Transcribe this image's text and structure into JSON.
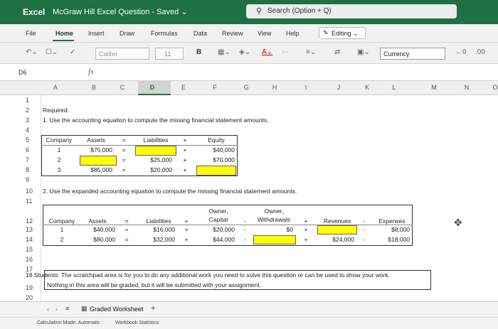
{
  "titlebar": {
    "app_name": "Excel",
    "document": "McGraw Hill Excel Question  -  Saved ⌄",
    "search_placeholder": "Search (Option + Q)"
  },
  "menu": {
    "file": "File",
    "home": "Home",
    "insert": "Insert",
    "draw": "Draw",
    "formulas": "Formulas",
    "data": "Data",
    "review": "Review",
    "view": "View",
    "help": "Help",
    "editing": "Editing ⌄"
  },
  "ribbon": {
    "font_name": "Calibri",
    "font_size": "11",
    "bold": "B",
    "number_format": "Currency"
  },
  "formula_bar": {
    "name_box": "D6",
    "fx": "fx"
  },
  "columns": [
    "A",
    "B",
    "C",
    "D",
    "E",
    "F",
    "G",
    "H",
    "I",
    "J",
    "K",
    "L",
    "M",
    "N",
    "O"
  ],
  "rows": [
    "1",
    "2",
    "3",
    "4",
    "5",
    "6",
    "7",
    "8",
    "9",
    "10",
    "11",
    "12",
    "13",
    "14",
    "15",
    "16",
    "17",
    "18",
    "19",
    "20"
  ],
  "sheet": {
    "required": "Required:",
    "instruction1": "1. Use the accounting equation to compute the missing financial statement amounts.",
    "t1_headers": {
      "company": "Company",
      "assets": "Assets",
      "eq": "=",
      "liabilities": "Liabilities",
      "plus": "+",
      "equity": "Equity"
    },
    "t1_rows": [
      {
        "company": "1",
        "assets": "$75,000",
        "eq": "=",
        "liabilities": "",
        "plus": "+",
        "equity": "$40,000"
      },
      {
        "company": "2",
        "assets": "",
        "eq": "=",
        "liabilities": "$25,000",
        "plus": "+",
        "equity": "$70,000"
      },
      {
        "company": "3",
        "assets": "$85,000",
        "eq": "=",
        "liabilities": "$20,000",
        "plus": "+",
        "equity": ""
      }
    ],
    "instruction2": "2. Use the expanded accounting equation to compute the missing financial statement amounts.",
    "t2_headers": {
      "company": "Company",
      "assets": "Assets",
      "eq": "=",
      "liabilities": "Liabilities",
      "plus1": "+",
      "owner_capital_1": "Owner,",
      "owner_capital_2": "Capital",
      "minus1": "-",
      "owner_withdrawals_1": "Owner,",
      "owner_withdrawals_2": "Withdrawals",
      "plus2": "+",
      "revenues": "Revenues",
      "minus2": "-",
      "expenses": "Expenses"
    },
    "t2_rows": [
      {
        "company": "1",
        "assets": "$40,000",
        "eq": "=",
        "liabilities": "$16,000",
        "plus1": "+",
        "capital": "$20,000",
        "minus1": "-",
        "withdrawals": "$0",
        "plus2": "+",
        "revenues": "",
        "minus2": "-",
        "expenses": "$8,000"
      },
      {
        "company": "2",
        "assets": "$80,000",
        "eq": "=",
        "liabilities": "$32,000",
        "plus1": "+",
        "capital": "$44,000",
        "minus1": "-",
        "withdrawals": "",
        "plus2": "+",
        "revenues": "$24,000",
        "minus2": "-",
        "expenses": "$18,000"
      }
    ],
    "scratch1": "18  Students: The scratchpad area is for you to do any additional work you need to solve this question or can be used to show your work.",
    "scratch2": "Nothing in this area will be graded, but it will be submitted with your assignment."
  },
  "sheet_tab": {
    "name": "Graded Worksheet",
    "add": "+"
  },
  "status": {
    "calc_mode": "Calculation Mode: Automatic",
    "stats": "Workbook Statistics"
  },
  "colors": {
    "excel_green": "#1f7044",
    "input_yellow": "#ffff00"
  }
}
